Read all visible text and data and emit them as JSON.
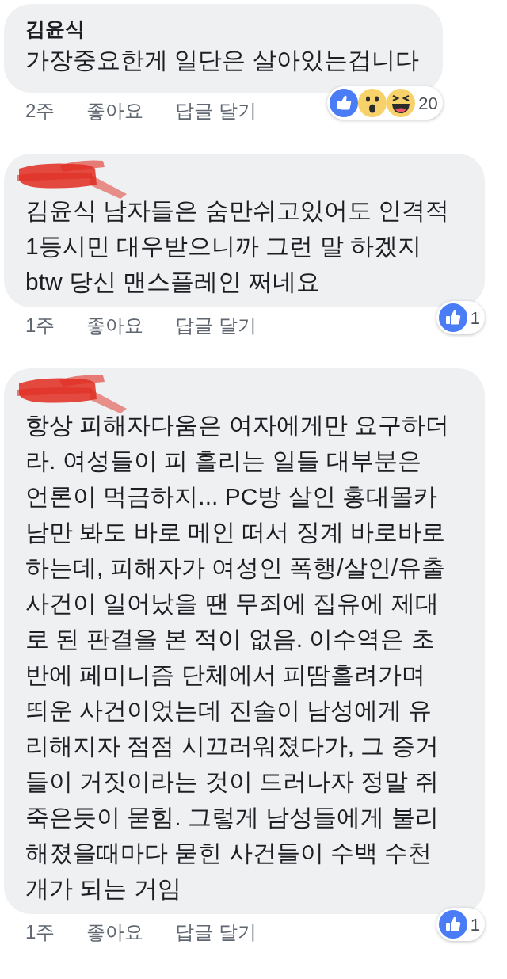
{
  "comments": [
    {
      "author": "김윤식",
      "author_redacted": false,
      "text": "가장중요한게 일단은 살아있는겁니다",
      "time": "2주",
      "like": "좋아요",
      "reply": "답글 달기",
      "reactions": [
        {
          "kind": "like"
        },
        {
          "kind": "wow"
        },
        {
          "kind": "haha"
        }
      ],
      "reaction_count": "20"
    },
    {
      "author_redacted": true,
      "text": "김윤식 남자들은 숨만쉬고있어도 인격적\n1등시민 대우받으니까 그런 말 하겠지\nbtw 당신 맨스플레인 쩌네요",
      "time": "1주",
      "like": "좋아요",
      "reply": "답글 달기",
      "reactions": [
        {
          "kind": "like"
        }
      ],
      "reaction_count": "1"
    },
    {
      "author_redacted": true,
      "text": "항상 피해자다움은 여자에게만 요구하더\n라. 여성들이 피 흘리는 일들 대부분은\n언론이 먹금하지... PC방 살인 홍대몰카\n남만 봐도 바로 메인 떠서 징계 바로바로\n하는데, 피해자가 여성인 폭행/살인/유출\n사건이 일어났을 땐 무죄에 집유에 제대\n로 된 판결을 본 적이 없음. 이수역은 초\n반에 페미니즘 단체에서 피땀흘려가며\n띄운 사건이었는데 진술이 남성에게 유\n리해지자 점점 시끄러워졌다가, 그 증거\n들이 거짓이라는 것이 드러나자 정말 쥐\n죽은듯이 묻힘. 그렇게 남성들에게 불리\n해졌을때마다 묻힌 사건들이 수백 수천\n개가 되는 거임",
      "time": "1주",
      "like": "좋아요",
      "reply": "답글 달기",
      "reactions": [
        {
          "kind": "like"
        }
      ],
      "reaction_count": "1"
    }
  ]
}
